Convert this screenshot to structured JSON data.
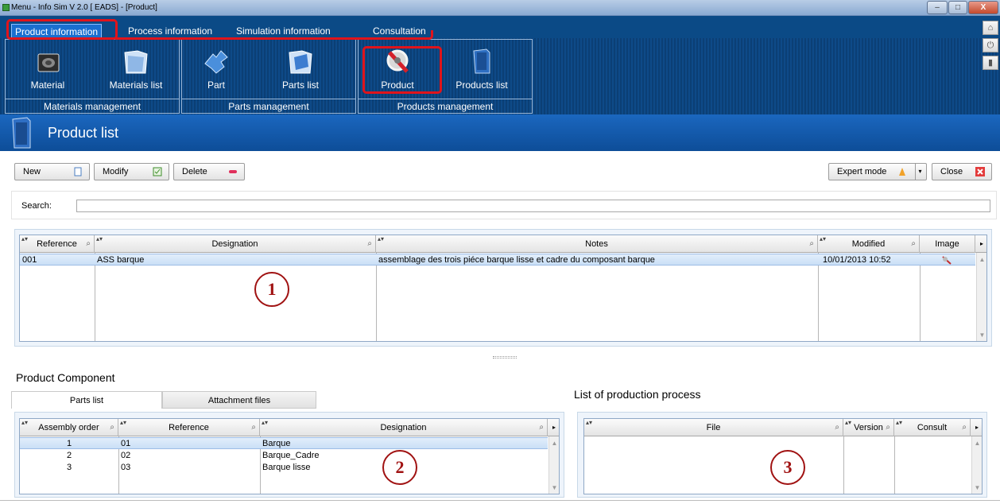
{
  "window": {
    "title": "Menu - Info Sim V 2.0 [ EADS] - [Product]",
    "minimize": "–",
    "maximize": "□",
    "close": "X"
  },
  "menu": {
    "tabs": [
      "Product information",
      "Process information",
      "Simulation information",
      "Consultation"
    ]
  },
  "ribbon": {
    "buttons": [
      "Material",
      "Materials list",
      "Part",
      "Parts list",
      "Product",
      "Products list"
    ],
    "groups": [
      "Materials management",
      "Parts management",
      "Products management"
    ]
  },
  "page": {
    "title": "Product list"
  },
  "toolbar": {
    "new": "New",
    "modify": "Modify",
    "delete": "Delete",
    "expert": "Expert mode",
    "close": "Close"
  },
  "search": {
    "label": "Search:",
    "value": ""
  },
  "products": {
    "columns": [
      "Reference",
      "Designation",
      "Notes",
      "Modified",
      "Image"
    ],
    "rows": [
      {
        "reference": "001",
        "designation": "ASS barque",
        "notes": "assemblage des trois piéce barque lisse et cadre du composant barque",
        "modified": "10/01/2013 10:52"
      }
    ]
  },
  "component": {
    "title": "Product Component",
    "tabs": [
      "Parts list",
      "Attachment files"
    ],
    "columns": [
      "Assembly order",
      "Reference",
      "Designation"
    ],
    "rows": [
      {
        "order": "1",
        "reference": "01",
        "designation": "Barque"
      },
      {
        "order": "2",
        "reference": "02",
        "designation": "Barque_Cadre"
      },
      {
        "order": "3",
        "reference": "03",
        "designation": "Barque lisse"
      }
    ]
  },
  "process": {
    "title": "List of production process",
    "columns": [
      "File",
      "Version",
      "Consult"
    ]
  },
  "markers": [
    "1",
    "2",
    "3"
  ],
  "colors": {
    "ribbon": "#0b4a86",
    "header": "#1b67bf",
    "highlight": "#e0141b",
    "marker": "#a01212"
  }
}
